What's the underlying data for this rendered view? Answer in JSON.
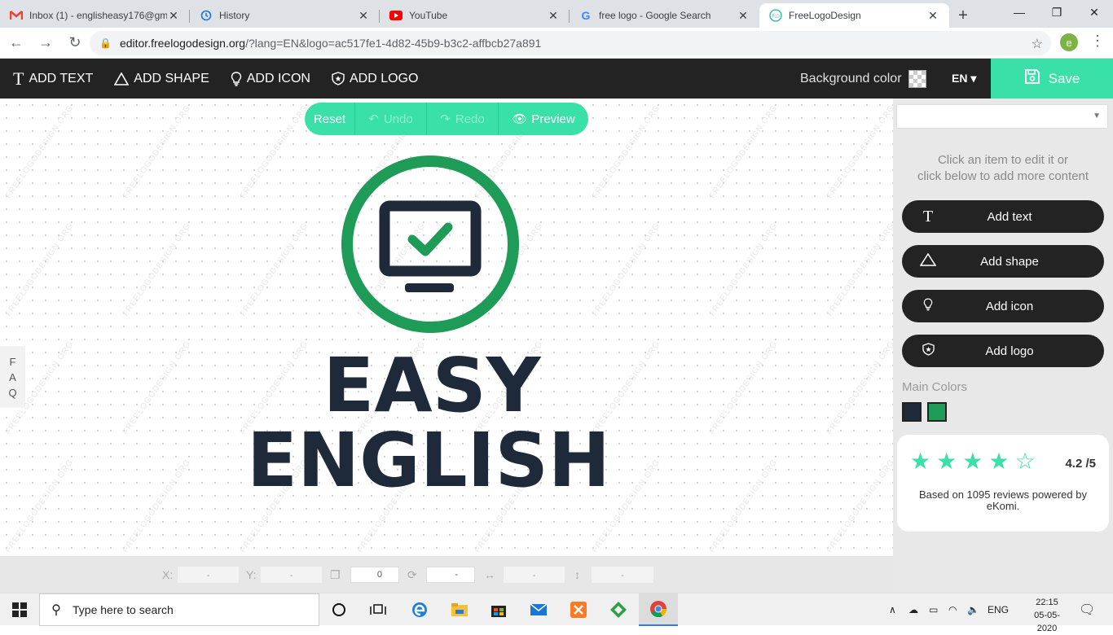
{
  "browser": {
    "tabs": [
      {
        "title": "Inbox (1) - englisheasy176@gm",
        "icon": "gmail-icon"
      },
      {
        "title": "History",
        "icon": "history-icon"
      },
      {
        "title": "YouTube",
        "icon": "youtube-icon"
      },
      {
        "title": "free logo - Google Search",
        "icon": "google-icon"
      },
      {
        "title": "FreeLogoDesign",
        "icon": "freelogodesign-icon",
        "active": true
      }
    ],
    "url_domain": "editor.freelogodesign.org",
    "url_path": "/?lang=EN&logo=ac517fe1-4d82-45b9-b3c2-affbcb27a891",
    "profile_initial": "e"
  },
  "toolbar": {
    "add_text": "ADD TEXT",
    "add_shape": "ADD SHAPE",
    "add_icon": "ADD ICON",
    "add_logo": "ADD LOGO",
    "background_color": "Background color",
    "lang": "EN ▾",
    "save": "Save"
  },
  "controls": {
    "reset": "Reset",
    "undo": "Undo",
    "redo": "Redo",
    "preview": "Preview"
  },
  "logo": {
    "line1": "EASY",
    "line2": "ENGLISH",
    "dark_color": "#1e2a3a",
    "green_color": "#1e9b57"
  },
  "watermark": "FREELOGODESIGN.ORG",
  "faq": [
    "F",
    "A",
    "Q"
  ],
  "coord_bar": {
    "x_label": "X:",
    "x_value": "-",
    "y_label": "Y:",
    "y_value": "-",
    "layer_value": "0",
    "rotate_value": "-",
    "width_value": "-",
    "height_value": "-"
  },
  "panel": {
    "hint_line1": "Click an item to edit it or",
    "hint_line2": "click below to add more content",
    "add_text": "Add text",
    "add_shape": "Add shape",
    "add_icon": "Add icon",
    "add_logo": "Add logo",
    "main_colors": "Main Colors",
    "colors": [
      "#1e2a3a",
      "#1e9b57"
    ]
  },
  "review": {
    "score": "4.2 /5",
    "filled_stars": 4,
    "total_stars": 5,
    "text": "Based on 1095 reviews powered by eKomi."
  },
  "taskbar": {
    "search_placeholder": "Type here to search",
    "lang": "ENG",
    "time": "22:15",
    "date": "05-05-2020"
  }
}
